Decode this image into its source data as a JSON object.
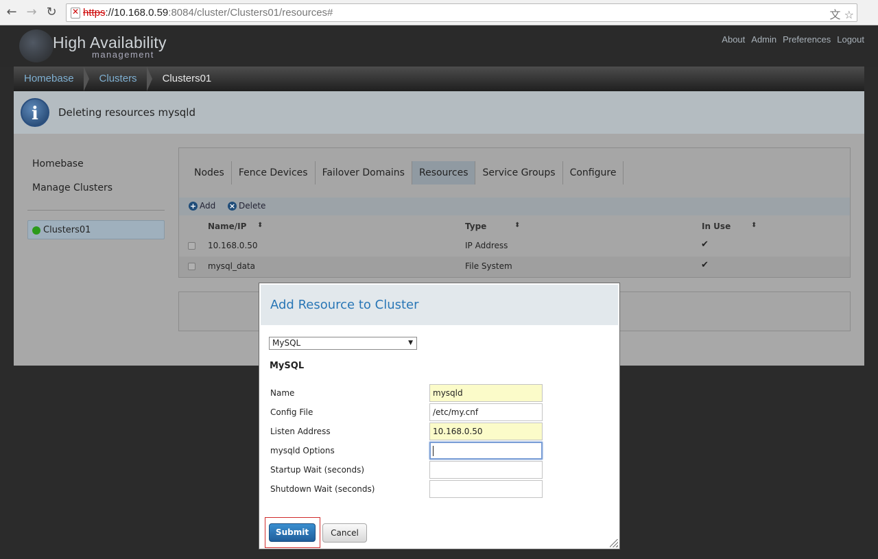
{
  "browser": {
    "url_scheme": "https",
    "url_host": "://10.168.0.59",
    "url_rest": ":8084/cluster/Clusters01/resources#",
    "back_icon": "←",
    "forward_icon": "→",
    "reload_icon": "↻",
    "translate_icon": "文",
    "star_icon": "☆"
  },
  "header": {
    "logo_title": "High Availability",
    "logo_subtitle": "management",
    "links": [
      "About",
      "Admin",
      "Preferences",
      "Logout"
    ]
  },
  "breadcrumb": [
    "Homebase",
    "Clusters",
    "Clusters01"
  ],
  "banner": {
    "icon": "i",
    "message": "Deleting resources mysqld"
  },
  "sidebar": {
    "links": [
      "Homebase",
      "Manage Clusters"
    ],
    "cluster": "Clusters01"
  },
  "tabs": [
    "Nodes",
    "Fence Devices",
    "Failover Domains",
    "Resources",
    "Service Groups",
    "Configure"
  ],
  "toolbar": {
    "add_icon": "+",
    "add_label": "Add",
    "delete_icon": "×",
    "delete_label": "Delete"
  },
  "table": {
    "columns": [
      "Name/IP",
      "Type",
      "In Use"
    ],
    "sort_icon": "⬍",
    "rows": [
      {
        "name": "10.168.0.50",
        "type": "IP Address",
        "in_use": "✔"
      },
      {
        "name": "mysql_data",
        "type": "File System",
        "in_use": "✔"
      }
    ]
  },
  "modal": {
    "title": "Add Resource to Cluster",
    "selected_type": "MySQL",
    "select_arrow": "▼",
    "section_title": "MySQL",
    "fields": [
      {
        "label": "Name",
        "value": "mysqld"
      },
      {
        "label": "Config File",
        "value": "/etc/my.cnf"
      },
      {
        "label": "Listen Address",
        "value": "10.168.0.50"
      },
      {
        "label": "mysqld Options",
        "value": ""
      },
      {
        "label": "Startup Wait (seconds)",
        "value": ""
      },
      {
        "label": "Shutdown Wait (seconds)",
        "value": ""
      }
    ],
    "submit_label": "Submit",
    "cancel_label": "Cancel"
  }
}
